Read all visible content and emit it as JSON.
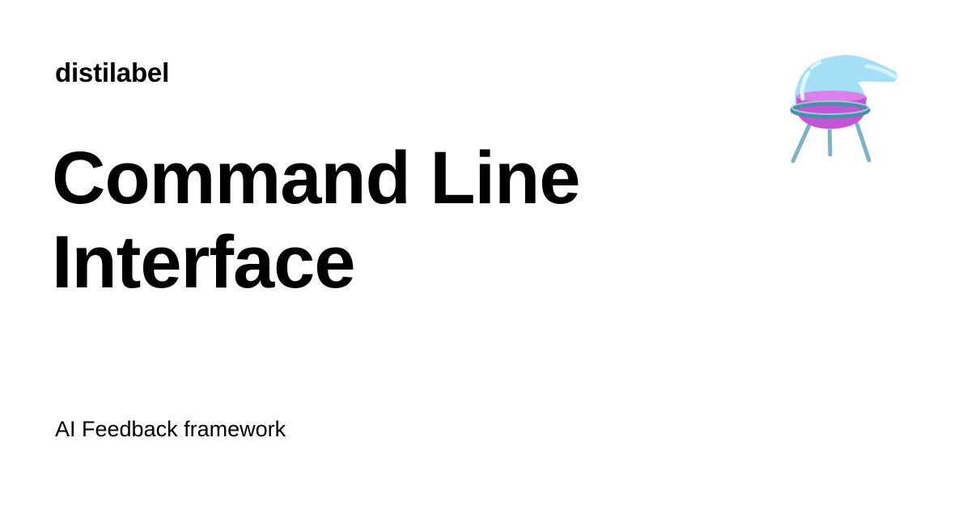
{
  "site": {
    "name": "distilabel"
  },
  "page": {
    "title_lines": [
      "Command Line",
      "Interface"
    ],
    "tagline": "AI Feedback framework"
  },
  "logo": {
    "icon": "flask-icon",
    "colors": {
      "glass": "#9fdcf7",
      "liquid": "#c356d8",
      "stand": "#7fb1c4"
    }
  }
}
